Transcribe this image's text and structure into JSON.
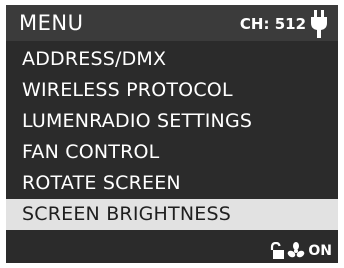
{
  "header": {
    "title": "MENU",
    "channel": "CH: 512",
    "power_icon": "plug-icon"
  },
  "menu": {
    "items": [
      {
        "label": "ADDRESS/DMX",
        "selected": false
      },
      {
        "label": "WIRELESS PROTOCOL",
        "selected": false
      },
      {
        "label": "LUMENRADIO SETTINGS",
        "selected": false
      },
      {
        "label": "FAN CONTROL",
        "selected": false
      },
      {
        "label": "ROTATE SCREEN",
        "selected": false
      },
      {
        "label": "SCREEN BRIGHTNESS",
        "selected": true
      }
    ]
  },
  "status_bar": {
    "lock_icon": "unlock-icon",
    "fan_icon": "fan-icon",
    "fan_status": "ON"
  },
  "colors": {
    "background": "#2b2b2b",
    "header": "#3b3b3b",
    "selected_row": "#e2e2e2",
    "text": "#ffffff"
  }
}
